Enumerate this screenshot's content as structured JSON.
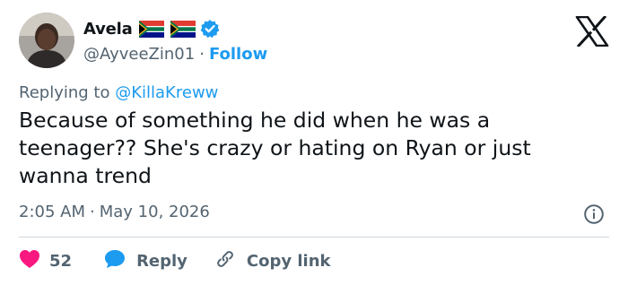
{
  "author": {
    "display_name": "Avela",
    "handle": "@AyveeZin01",
    "separator": "·",
    "follow_label": "Follow",
    "avatar_icon": "user-avatar",
    "flag_icons": [
      "south-africa-flag-icon",
      "south-africa-flag-icon"
    ],
    "verified_icon": "verified-badge-icon"
  },
  "platform_logo": "x-logo-icon",
  "reply_context": {
    "prefix": "Replying to",
    "mention": "@KillaKreww"
  },
  "tweet": {
    "text": "Because of something he did when he was a\nteenager?? She's crazy or hating on Ryan or just\nwanna trend",
    "time": "2:05 AM",
    "separator": "·",
    "date": "May 10, 2026"
  },
  "actions": {
    "like_count": "52",
    "reply_label": "Reply",
    "copy_link_label": "Copy link"
  },
  "colors": {
    "text": "#0f1419",
    "secondary": "#536471",
    "accent": "#1d9bf0",
    "like": "#f91880",
    "divider": "#cfd9de"
  }
}
